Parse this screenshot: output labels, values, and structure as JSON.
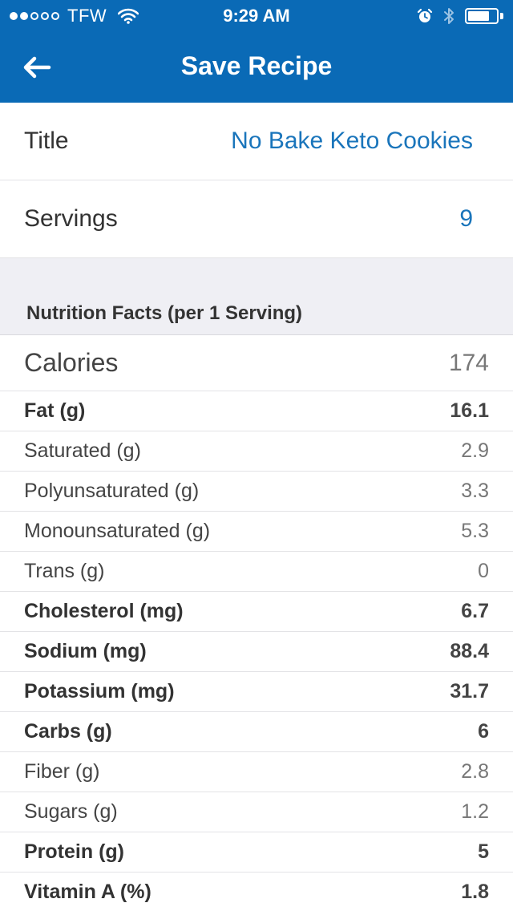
{
  "status_bar": {
    "signal_filled": 2,
    "signal_total": 5,
    "carrier": "TFW",
    "time": "9:29 AM",
    "battery_level": 0.7,
    "icons": [
      "wifi-icon",
      "alarm-icon",
      "bluetooth-icon",
      "battery-icon"
    ]
  },
  "navbar": {
    "back_icon": "arrow-left-icon",
    "title": "Save Recipe"
  },
  "form": {
    "title_label": "Title",
    "title_value": "No Bake Keto Cookies",
    "servings_label": "Servings",
    "servings_value": "9"
  },
  "nutrition": {
    "header": "Nutrition Facts (per 1 Serving)",
    "calories_label": "Calories",
    "calories_value": "174",
    "rows": [
      {
        "label": "Fat (g)",
        "value": "16.1",
        "bold": true
      },
      {
        "label": "Saturated (g)",
        "value": "2.9",
        "bold": false
      },
      {
        "label": "Polyunsaturated (g)",
        "value": "3.3",
        "bold": false
      },
      {
        "label": "Monounsaturated (g)",
        "value": "5.3",
        "bold": false
      },
      {
        "label": "Trans (g)",
        "value": "0",
        "bold": false
      },
      {
        "label": "Cholesterol (mg)",
        "value": "6.7",
        "bold": true
      },
      {
        "label": "Sodium (mg)",
        "value": "88.4",
        "bold": true
      },
      {
        "label": "Potassium (mg)",
        "value": "31.7",
        "bold": true
      },
      {
        "label": "Carbs (g)",
        "value": "6",
        "bold": true
      },
      {
        "label": "Fiber (g)",
        "value": "2.8",
        "bold": false
      },
      {
        "label": "Sugars (g)",
        "value": "1.2",
        "bold": false
      },
      {
        "label": "Protein (g)",
        "value": "5",
        "bold": true
      },
      {
        "label": "Vitamin A (%)",
        "value": "1.8",
        "bold": true
      }
    ]
  },
  "colors": {
    "brand": "#0a6ab6",
    "value_link": "#1a75bb",
    "section_bg": "#efeff4"
  }
}
